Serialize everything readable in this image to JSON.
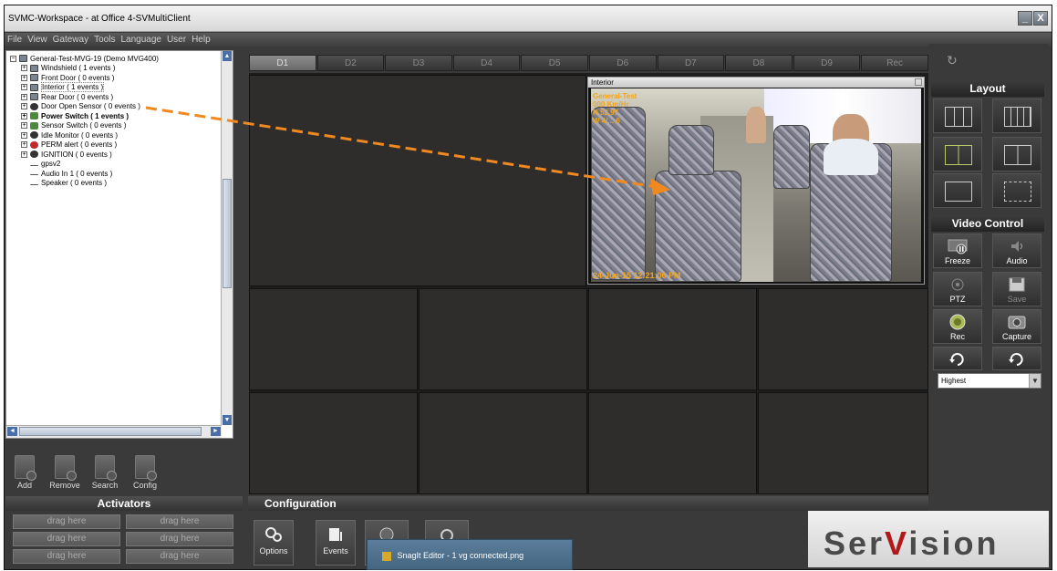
{
  "window": {
    "title": "SVMC-Workspace - at Office 4-SVMultiClient",
    "minimize": "_",
    "close": "X"
  },
  "menu": [
    "File",
    "View",
    "Gateway",
    "Tools",
    "Language",
    "User",
    "Help"
  ],
  "tree": {
    "root": "General-Test-MVG-19 (Demo MVG400)",
    "items": [
      {
        "label": "Windshield ( 1 events )",
        "icon": "camera-icon"
      },
      {
        "label": "Front Door ( 0 events )",
        "icon": "camera-icon"
      },
      {
        "label": "Interior ( 1 events )",
        "icon": "camera-icon"
      },
      {
        "label": "Rear Door ( 0 events )",
        "icon": "camera-icon"
      },
      {
        "label": "Door Open Sensor ( 0 events )",
        "icon": "sensor-icon"
      },
      {
        "label": "Power Switch ( 1 events )",
        "icon": "switch-icon"
      },
      {
        "label": "Sensor Switch ( 0 events )",
        "icon": "switch-icon"
      },
      {
        "label": "Idle Monitor ( 0 events )",
        "icon": "sensor-icon"
      },
      {
        "label": "PERM alert ( 0 events )",
        "icon": "alert-icon"
      },
      {
        "label": "IGNITION ( 0 events )",
        "icon": "sensor-icon"
      },
      {
        "label": "gpsv2",
        "icon": "gps-icon"
      },
      {
        "label": "Audio In 1 ( 0 events )",
        "icon": "audio-icon"
      },
      {
        "label": "Speaker ( 0 events )",
        "icon": "speaker-icon"
      }
    ]
  },
  "tools": [
    "Add",
    "Remove",
    "Search",
    "Config"
  ],
  "activators": {
    "title": "Activators",
    "slot": "drag here"
  },
  "configuration": {
    "title": "Configuration",
    "buttons": [
      "Options",
      "Events"
    ]
  },
  "tabs": [
    "D1",
    "D2",
    "D3",
    "D4",
    "D5",
    "D6",
    "D7",
    "D8",
    "D9",
    "Rec"
  ],
  "video": {
    "title": "Interior",
    "timestamp": "24-Jun-15 12:21:06 PM",
    "osd_lines": [
      "General-Test",
      "000 Km/Hr",
      "N 52.97",
      "W 4/... 6"
    ]
  },
  "right_panel": {
    "layout_title": "Layout",
    "video_control_title": "Video Control",
    "controls": [
      "Freeze",
      "Audio",
      "PTZ",
      "Save",
      "Rec",
      "Capture"
    ],
    "quality": "Highest"
  },
  "taskbar": {
    "snagit": "SnagIt Editor - 1 vg connected.png"
  },
  "brand": {
    "pre": "Ser",
    "v": "V",
    "post": "ision"
  },
  "colors": {
    "accent_orange": "#f0891f",
    "brand_red": "#b11a1a"
  }
}
